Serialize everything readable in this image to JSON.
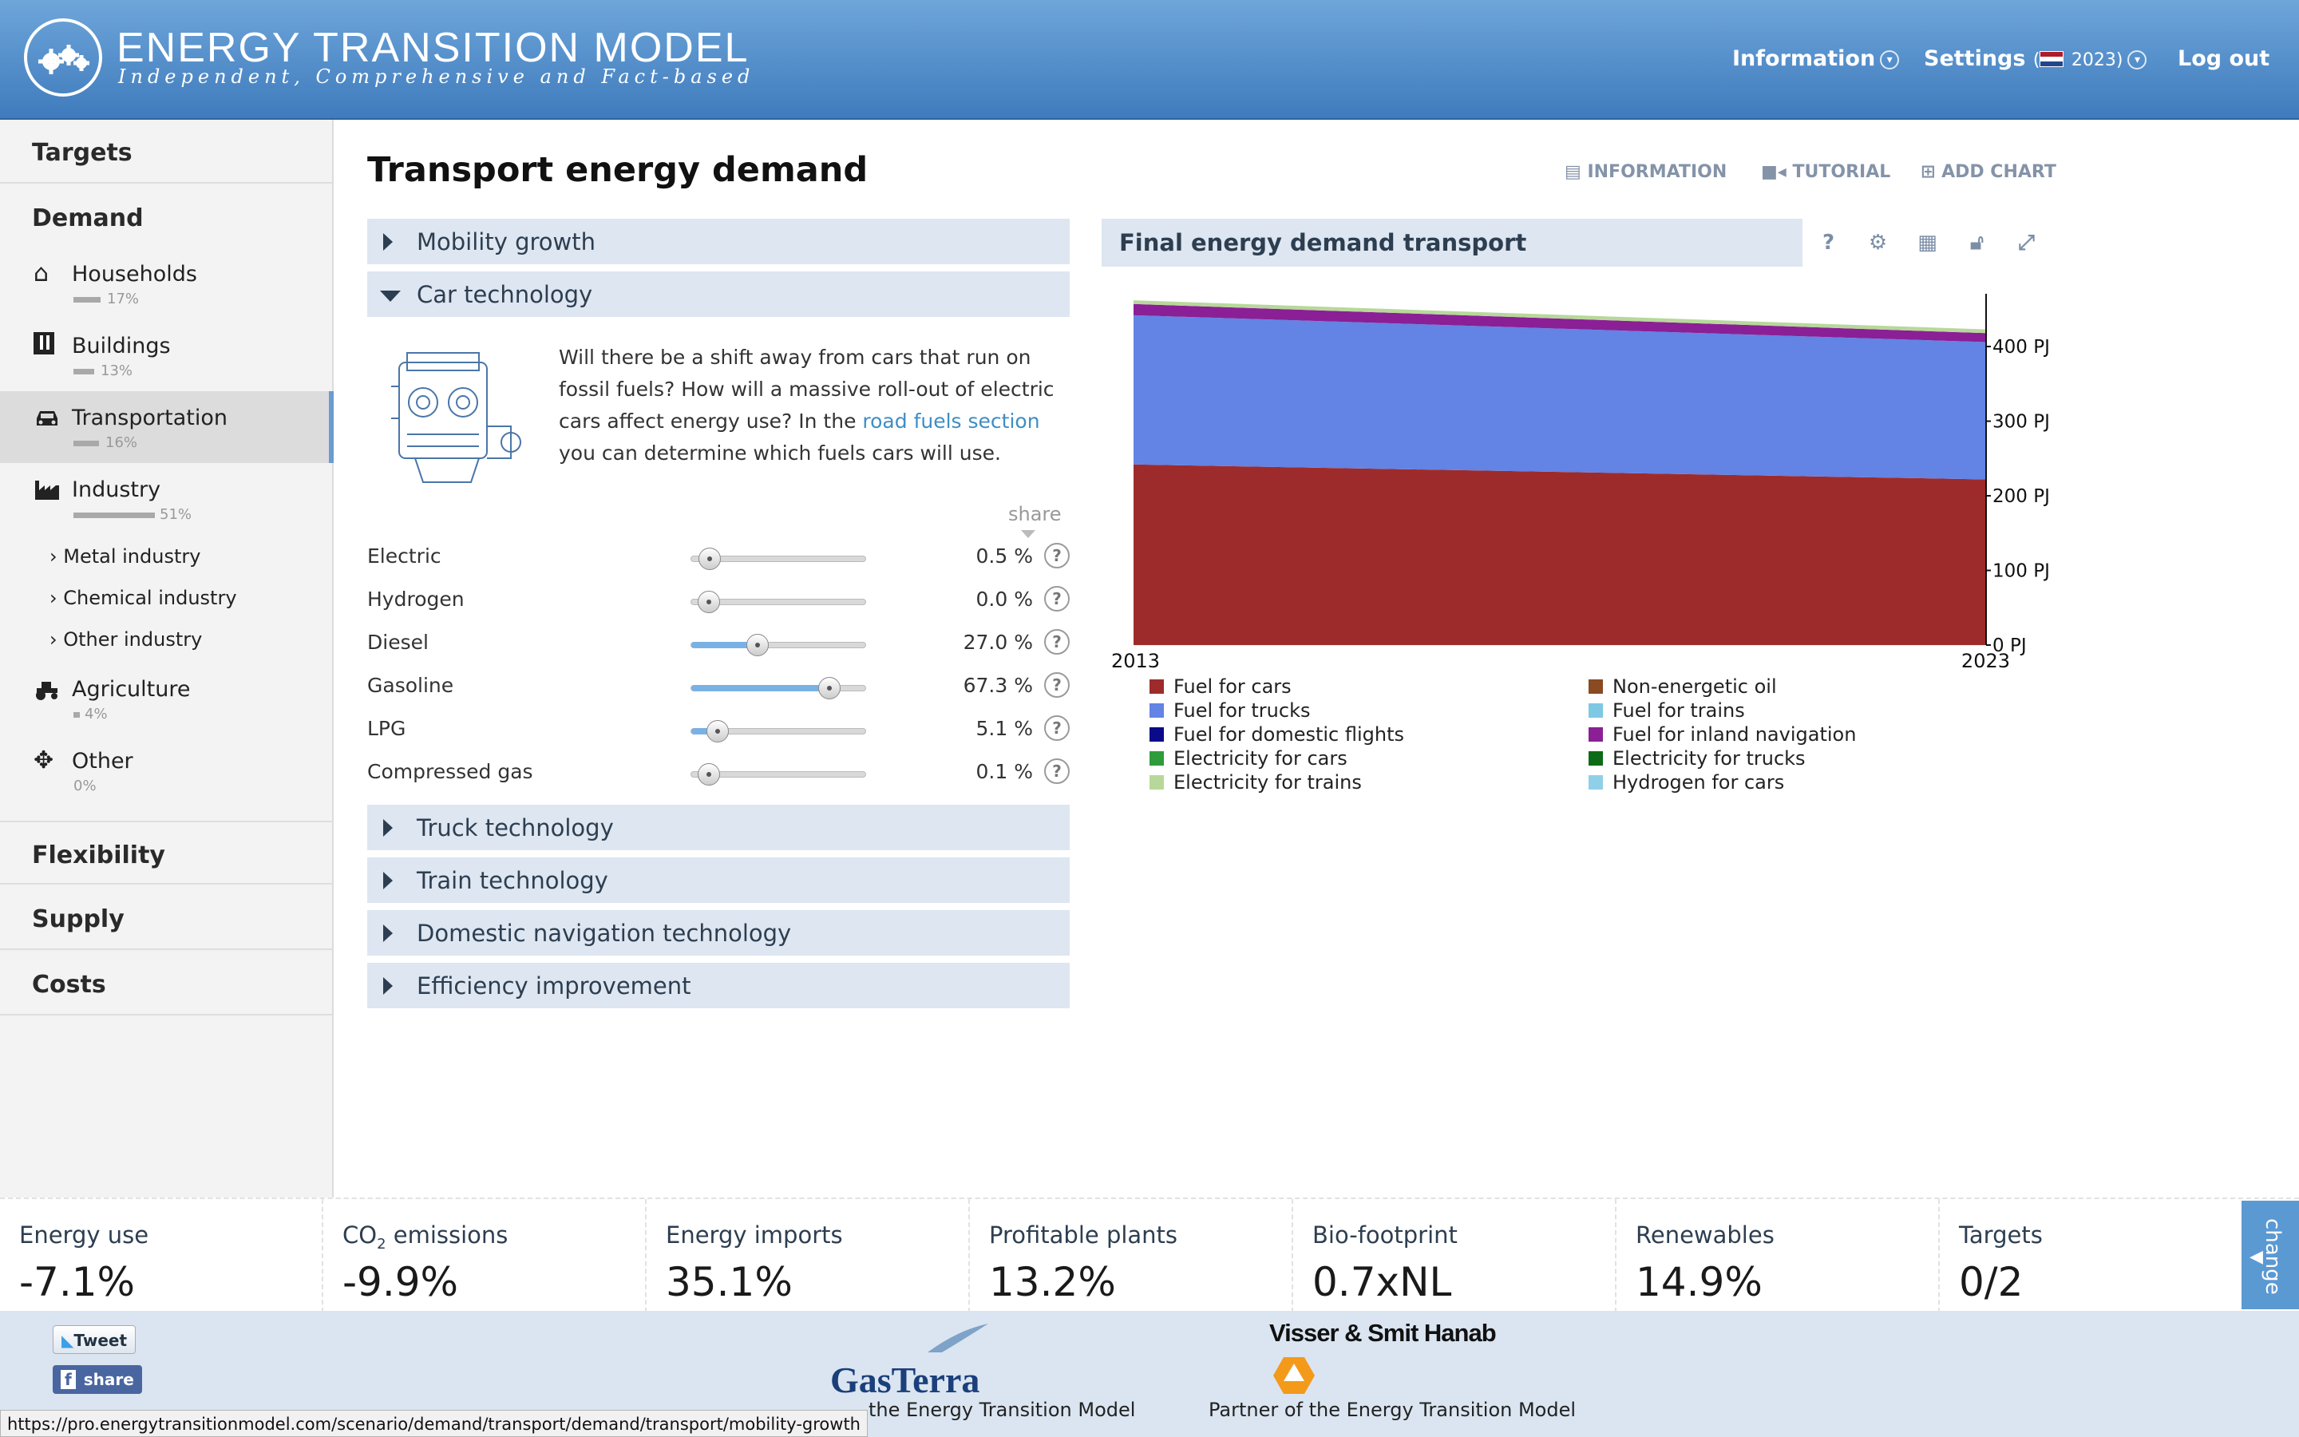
{
  "header": {
    "title": "ENERGY TRANSITION MODEL",
    "subtitle": "Independent, Comprehensive and Fact-based",
    "nav_information": "Information",
    "nav_settings": "Settings",
    "settings_year": "2023",
    "nav_logout": "Log out"
  },
  "sidebar": {
    "targets": "Targets",
    "demand": "Demand",
    "items": [
      {
        "label": "Households",
        "pct": "17%",
        "share": 0.17,
        "icon": "house-icon"
      },
      {
        "label": "Buildings",
        "pct": "13%",
        "share": 0.13,
        "icon": "building-icon"
      },
      {
        "label": "Transportation",
        "pct": "16%",
        "share": 0.16,
        "icon": "car-icon"
      },
      {
        "label": "Industry",
        "pct": "51%",
        "share": 0.51,
        "icon": "factory-icon"
      },
      {
        "label": "Agriculture",
        "pct": "4%",
        "share": 0.04,
        "icon": "tractor-icon"
      },
      {
        "label": "Other",
        "pct": "0%",
        "share": 0.0,
        "icon": "move-icon"
      }
    ],
    "industry_sub": [
      "Metal industry",
      "Chemical industry",
      "Other industry"
    ],
    "flexibility": "Flexibility",
    "supply": "Supply",
    "costs": "Costs"
  },
  "main": {
    "page_title": "Transport energy demand",
    "toolbar": {
      "information": "INFORMATION",
      "tutorial": "TUTORIAL",
      "add_chart": "ADD CHART"
    },
    "accordion_top": [
      "Mobility growth",
      "Car technology"
    ],
    "description": {
      "before": "Will there be a shift away from cars that run on fossil fuels? How will a massive roll-out of electric cars affect energy use? In the ",
      "link": "road fuels section",
      "after": " you can determine which fuels cars will use."
    },
    "share_header": "share",
    "sliders": [
      {
        "name": "Electric",
        "value": "0.5 %",
        "share": 0.005
      },
      {
        "name": "Hydrogen",
        "value": "0.0 %",
        "share": 0.0
      },
      {
        "name": "Diesel",
        "value": "27.0 %",
        "share": 0.27
      },
      {
        "name": "Gasoline",
        "value": "67.3 %",
        "share": 0.673
      },
      {
        "name": "LPG",
        "value": "5.1 %",
        "share": 0.051
      },
      {
        "name": "Compressed gas",
        "value": "0.1 %",
        "share": 0.001
      }
    ],
    "accordion_bottom": [
      "Truck technology",
      "Train technology",
      "Domestic navigation technology",
      "Efficiency improvement"
    ]
  },
  "chart": {
    "title": "Final energy demand transport",
    "buttons": [
      "?"
    ]
  },
  "chart_data": {
    "type": "area",
    "x": [
      2013,
      2023
    ],
    "x_tick_labels": [
      "2013",
      "2023"
    ],
    "y_unit": "PJ",
    "ylim": [
      0,
      460
    ],
    "y_ticks": [
      0,
      100,
      200,
      300,
      400
    ],
    "y_tick_labels": [
      "0 PJ",
      "100 PJ",
      "200 PJ",
      "300 PJ",
      "400 PJ"
    ],
    "y_axis_side": "right",
    "legend_placement": "bottom",
    "series": [
      {
        "name": "Fuel for cars",
        "color": "#9e2b2b",
        "values": [
          242,
          222
        ]
      },
      {
        "name": "Fuel for trucks",
        "color": "#6383e5",
        "values": [
          200,
          184
        ]
      },
      {
        "name": "Fuel for inland navigation",
        "color": "#8b1f95",
        "values": [
          15,
          12
        ]
      },
      {
        "name": "Electricity for trains",
        "color": "#b7d89a",
        "values": [
          5,
          5
        ]
      },
      {
        "name": "Non-energetic oil",
        "color": "#8a4a22",
        "values": [
          0,
          0
        ]
      },
      {
        "name": "Fuel for trains",
        "color": "#7ec8e3",
        "values": [
          0,
          0
        ]
      },
      {
        "name": "Fuel for domestic flights",
        "color": "#0a0a8a",
        "values": [
          0,
          0
        ]
      },
      {
        "name": "Electricity for cars",
        "color": "#2e9c3a",
        "values": [
          0,
          0
        ]
      },
      {
        "name": "Electricity for trucks",
        "color": "#0d6b17",
        "values": [
          0,
          0
        ]
      },
      {
        "name": "Hydrogen for cars",
        "color": "#8fd0e8",
        "values": [
          0,
          0
        ]
      }
    ],
    "legend_order": [
      "Fuel for cars",
      "Non-energetic oil",
      "Fuel for trucks",
      "Fuel for trains",
      "Fuel for domestic flights",
      "Fuel for inland navigation",
      "Electricity for cars",
      "Electricity for trucks",
      "Electricity for trains",
      "Hydrogen for cars"
    ]
  },
  "kpis": [
    {
      "label_pre": "Energy use",
      "label_sub": "",
      "label_post": "",
      "value": "-7.1%"
    },
    {
      "label_pre": "CO",
      "label_sub": "2",
      "label_post": " emissions",
      "value": "-9.9%"
    },
    {
      "label_pre": "Energy imports",
      "label_sub": "",
      "label_post": "",
      "value": "35.1%"
    },
    {
      "label_pre": "Profitable plants",
      "label_sub": "",
      "label_post": "",
      "value": "13.2%"
    },
    {
      "label_pre": "Bio-footprint",
      "label_sub": "",
      "label_post": "",
      "value": "0.7xNL"
    },
    {
      "label_pre": "Renewables",
      "label_sub": "",
      "label_post": "",
      "value": "14.9%"
    },
    {
      "label_pre": "Targets",
      "label_sub": "",
      "label_post": "",
      "value": "0/2"
    }
  ],
  "change_tab": "change",
  "footer": {
    "tweet": "Tweet",
    "share": "share",
    "gasterra_logo": "GasTerra",
    "gasterra_caption": "the Energy Transition Model",
    "vsh_logo": "Visser & Smit Hanab",
    "vsh_caption": "Partner of the Energy Transition Model"
  },
  "status_url": "https://pro.energytransitionmodel.com/scenario/demand/transport/demand/transport/mobility-growth"
}
